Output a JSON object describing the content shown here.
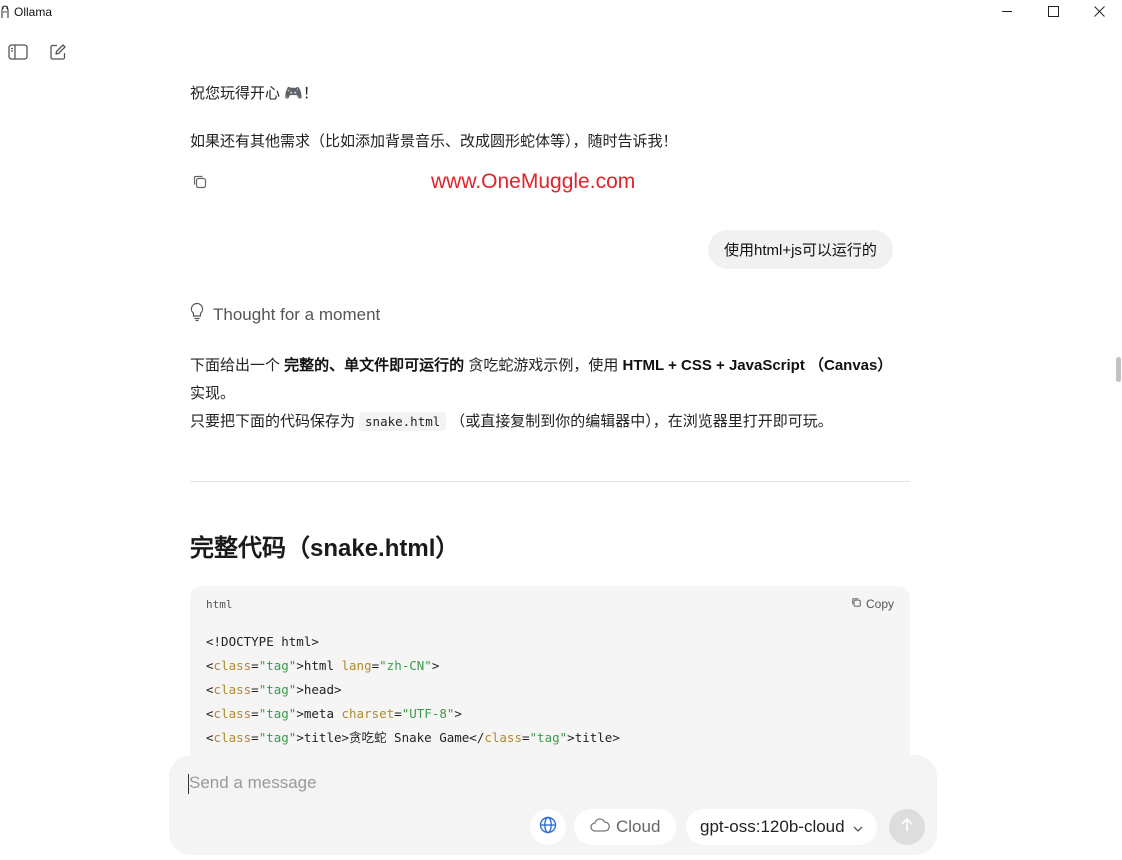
{
  "window": {
    "title": "Ollama",
    "minimize_icon": "minimize-icon",
    "maximize_icon": "maximize-icon",
    "close_icon": "close-icon"
  },
  "sidebar": {
    "toggle_icon": "sidebar-toggle-icon",
    "new_chat_icon": "new-chat-icon"
  },
  "messages": {
    "assistant_prev": {
      "line1": "祝您玩得开心 🎮！",
      "line2": "如果还有其他需求（比如添加背景音乐、改成圆形蛇体等），随时告诉我！",
      "copy_icon": "copy-icon"
    },
    "watermark": "www.OneMuggle.com",
    "user": {
      "text": "使用html+js可以运行的"
    },
    "assistant": {
      "thought_icon": "lightbulb-icon",
      "thought_label": "Thought for a moment",
      "intro_pre": "下面给出一个 ",
      "intro_bold1": "完整的、单文件即可运行的",
      "intro_mid": " 贪吃蛇游戏示例，使用 ",
      "intro_bold2": "HTML + CSS + JavaScript （Canvas）",
      "intro_post": " 实现。",
      "save_pre": "只要把下面的代码保存为",
      "save_code": "snake.html",
      "save_post": "（或直接复制到你的编辑器中），在浏览器里打开即可玩。",
      "heading": "完整代码（snake.html）",
      "code_block": {
        "language": "html",
        "copy_label": "Copy",
        "copy_icon": "copy-icon",
        "lines": [
          "<!DOCTYPE html>",
          "<html lang=\"zh-CN\">",
          "<head>",
          "<meta charset=\"UTF-8\">",
          "<title>贪吃蛇 Snake Game</title>"
        ]
      }
    }
  },
  "composer": {
    "placeholder": "Send a message",
    "web_search_icon": "globe-icon",
    "cloud_label": "Cloud",
    "cloud_icon": "cloud-icon",
    "model_label": "gpt-oss:120b-cloud",
    "model_icon": "chevron-down-icon",
    "send_icon": "arrow-up-icon"
  },
  "colors": {
    "watermark": "#e0242b",
    "tag": "#d14a3c",
    "attr": "#b08a2e",
    "string": "#3e9a4c"
  }
}
